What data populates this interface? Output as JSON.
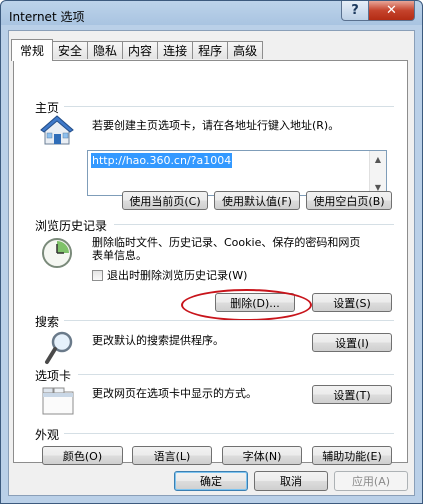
{
  "window": {
    "title": "Internet 选项",
    "help_label": "?",
    "close_label": "✕"
  },
  "tabs": [
    "常规",
    "安全",
    "隐私",
    "内容",
    "连接",
    "程序",
    "高级"
  ],
  "home": {
    "section": "主页",
    "desc": "若要创建主页选项卡，请在各地址行键入地址(R)。",
    "url": "http://hao.360.cn/?a1004",
    "btn_current": "使用当前页(C)",
    "btn_default": "使用默认值(F)",
    "btn_blank": "使用空白页(B)"
  },
  "history": {
    "section": "浏览历史记录",
    "desc_line1": "删除临时文件、历史记录、Cookie、保存的密码和网页",
    "desc_line2": "表单信息。",
    "checkbox_label": "退出时删除浏览历史记录(W)",
    "checkbox_checked": false,
    "btn_delete": "删除(D)...",
    "btn_settings": "设置(S)"
  },
  "search": {
    "section": "搜索",
    "desc": "更改默认的搜索提供程序。",
    "btn_settings": "设置(I)"
  },
  "tabsec": {
    "section": "选项卡",
    "desc": "更改网页在选项卡中显示的方式。",
    "btn_settings": "设置(T)"
  },
  "appearance": {
    "section": "外观",
    "btn_colors": "颜色(O)",
    "btn_languages": "语言(L)",
    "btn_fonts": "字体(N)",
    "btn_accessibility": "辅助功能(E)"
  },
  "footer": {
    "ok": "确定",
    "cancel": "取消",
    "apply": "应用(A)"
  },
  "icons": [
    "house-icon",
    "history-clock-icon",
    "magnifier-icon",
    "tabs-window-icon"
  ]
}
